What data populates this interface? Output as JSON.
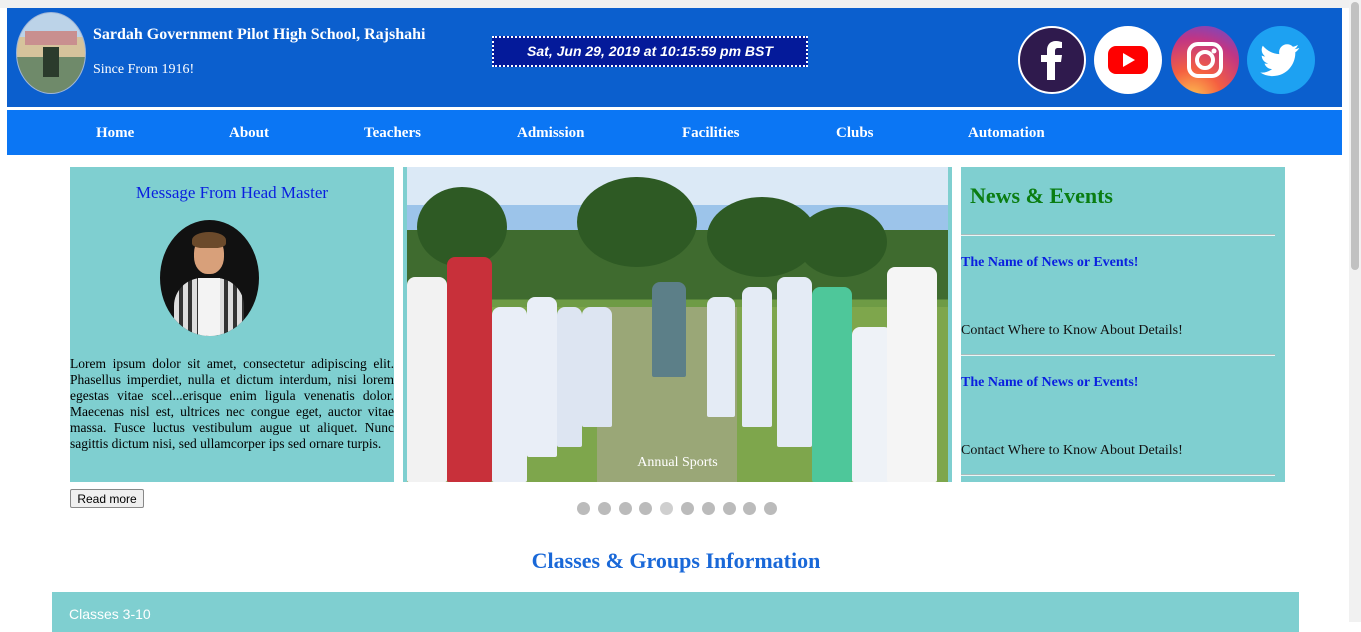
{
  "header": {
    "school_name": "Sardah Government Pilot High School, Rajshahi",
    "since": "Since From 1916!",
    "datetime": "Sat, Jun 29, 2019 at 10:15:59 pm BST",
    "social": [
      "facebook-icon",
      "youtube-icon",
      "instagram-icon",
      "twitter-icon"
    ]
  },
  "nav": {
    "items": [
      {
        "label": "Home"
      },
      {
        "label": "About"
      },
      {
        "label": "Teachers"
      },
      {
        "label": "Admission"
      },
      {
        "label": "Facilities"
      },
      {
        "label": "Clubs"
      },
      {
        "label": "Automation"
      }
    ]
  },
  "message": {
    "title": "Message From Head Master",
    "text": "Lorem ipsum dolor sit amet, consectetur adipiscing elit. Phasellus imperdiet, nulla et dictum interdum, nisi lorem egestas vitae scel...erisque enim ligula venenatis dolor. Maecenas nisl est, ultrices nec congue eget, auctor vitae massa. Fusce luctus vestibulum augue ut aliquet. Nunc sagittis dictum nisi, sed ullamcorper ips sed ornare turpis.",
    "read_more": "Read more"
  },
  "slider": {
    "caption": "Annual Sports",
    "dot_count": 10,
    "active_dot": 5
  },
  "news": {
    "title": "News & Events",
    "items": [
      {
        "name": "The Name of News or Events!",
        "detail": "Contact Where to Know About Details!"
      },
      {
        "name": "The Name of News or Events!",
        "detail": "Contact Where to Know About Details!"
      }
    ]
  },
  "classes": {
    "title": "Classes & Groups Information",
    "first_group": "Classes 3-10"
  },
  "colors": {
    "header_bg": "#0b5fce",
    "nav_bg": "#0b76f4",
    "panel_bg": "#7fcfd0",
    "news_title": "#0a7d12",
    "link": "#0a1fdf"
  }
}
